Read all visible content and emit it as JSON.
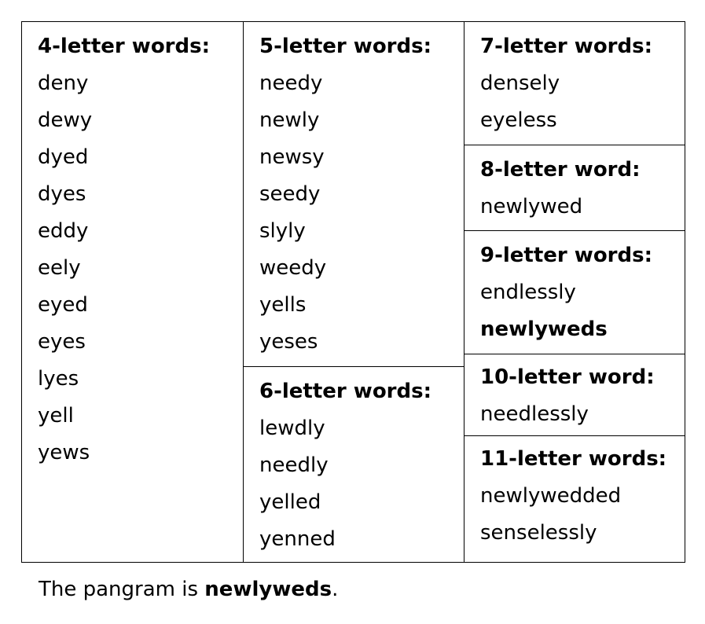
{
  "columns": {
    "four": {
      "heading": "4-letter words:",
      "words": [
        "deny",
        "dewy",
        "dyed",
        "dyes",
        "eddy",
        "eely",
        "eyed",
        "eyes",
        "lyes",
        "yell",
        "yews"
      ]
    },
    "five": {
      "heading": "5-letter words:",
      "words": [
        "needy",
        "newly",
        "newsy",
        "seedy",
        "slyly",
        "weedy",
        "yells",
        "yeses"
      ]
    },
    "six": {
      "heading": "6-letter words:",
      "words": [
        "lewdly",
        "needly",
        "yelled",
        "yenned"
      ]
    },
    "seven": {
      "heading": "7-letter words:",
      "words": [
        "densely",
        "eyeless"
      ]
    },
    "eight": {
      "heading": "8-letter word:",
      "words": [
        "newlywed"
      ]
    },
    "nine": {
      "heading": "9-letter words:",
      "words": [
        "endlessly",
        "newlyweds"
      ]
    },
    "ten": {
      "heading": "10-letter word:",
      "words": [
        "needlessly"
      ]
    },
    "eleven": {
      "heading": "11-letter words:",
      "words": [
        "newlywedded",
        "senselessly"
      ]
    }
  },
  "footer": {
    "prefix": "The pangram is ",
    "pangram": "newlyweds",
    "suffix": "."
  }
}
